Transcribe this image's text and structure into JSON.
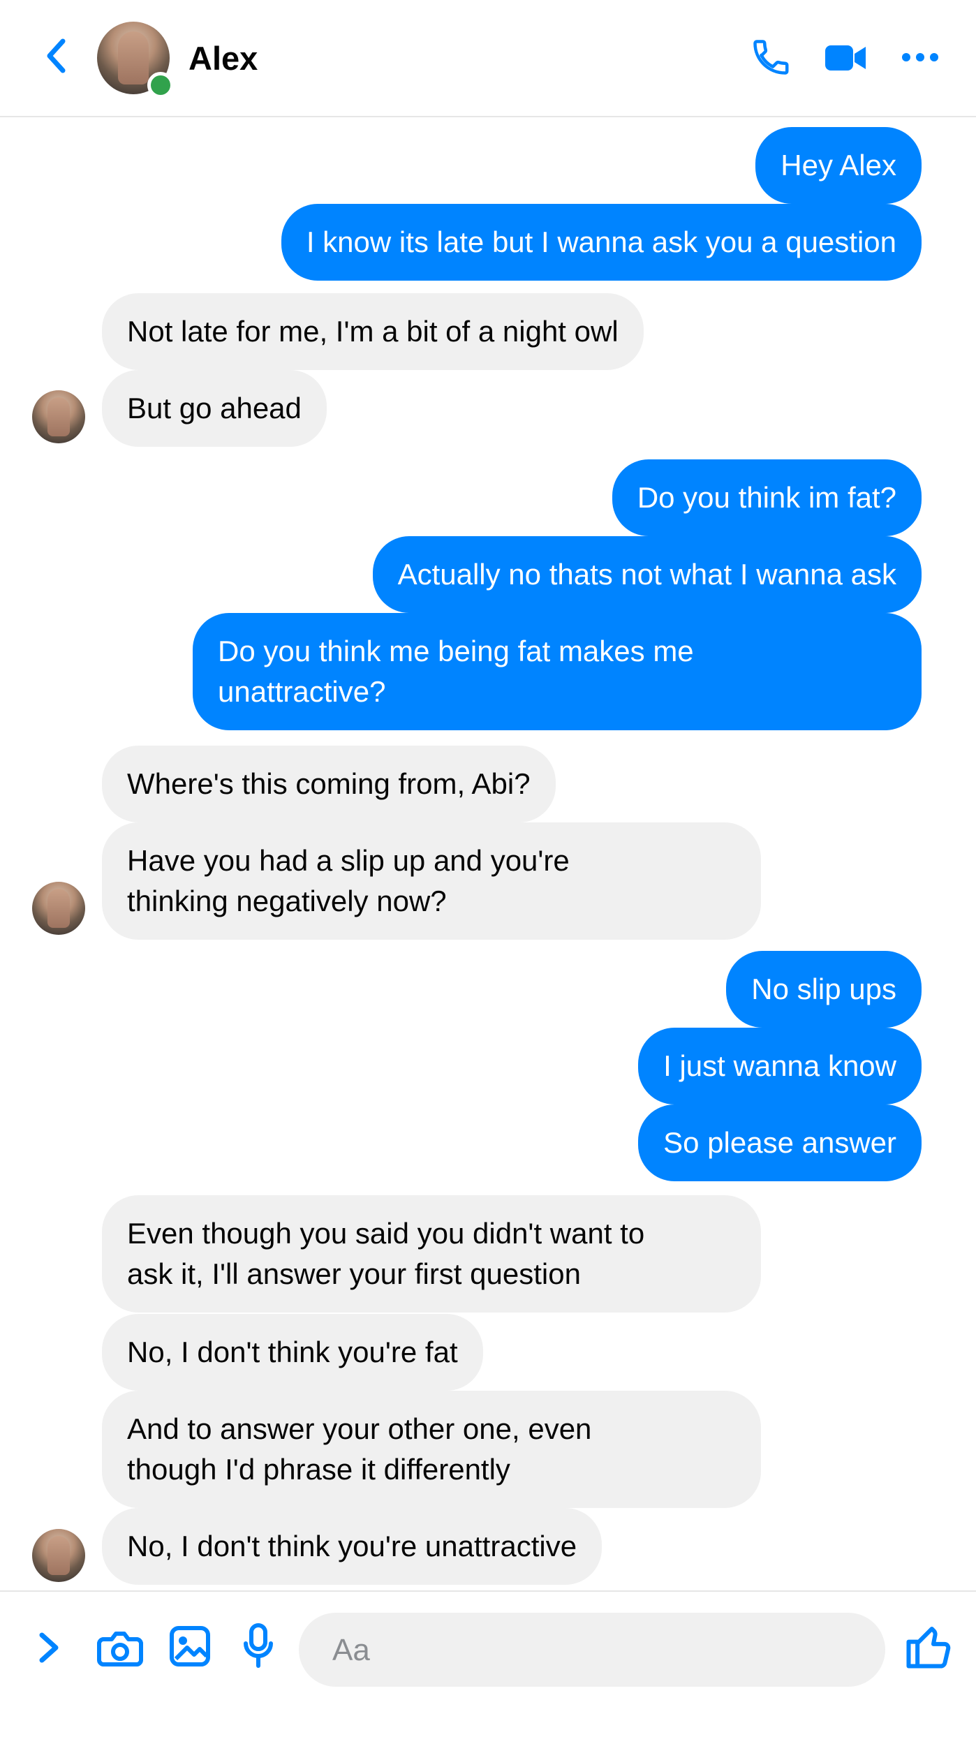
{
  "header": {
    "contact_name": "Alex",
    "online": true,
    "icons": [
      "back-chevron-icon",
      "phone-icon",
      "video-camera-icon",
      "more-icon"
    ]
  },
  "messages": [
    {
      "from": "me",
      "text": "Hey Alex"
    },
    {
      "from": "me",
      "text": "I know its late but I wanna ask you a question"
    },
    {
      "from": "them",
      "text": "Not late for me, I'm a bit of a night owl"
    },
    {
      "from": "them",
      "text": "But go ahead"
    },
    {
      "from": "me",
      "text": "Do you think im fat?"
    },
    {
      "from": "me",
      "text": "Actually no thats not what I wanna ask"
    },
    {
      "from": "me",
      "text": "Do you think me being fat makes me\nunattractive?"
    },
    {
      "from": "them",
      "text": "Where's this coming from, Abi?"
    },
    {
      "from": "them",
      "text": "Have you had a slip up and you're\nthinking negatively now?"
    },
    {
      "from": "me",
      "text": "No slip ups"
    },
    {
      "from": "me",
      "text": "I just wanna know"
    },
    {
      "from": "me",
      "text": "So please answer"
    },
    {
      "from": "them",
      "text": "Even though you said you didn't want to\nask it, I'll answer your first question"
    },
    {
      "from": "them",
      "text": "No, I don't think you're fat"
    },
    {
      "from": "them",
      "text": "And to answer your other one, even\nthough I'd phrase it differently"
    },
    {
      "from": "them",
      "text": "No, I don't think you're unattractive"
    }
  ],
  "composer": {
    "placeholder": "Aa",
    "value": "",
    "icons": [
      "expand-chevron-icon",
      "camera-icon",
      "image-icon",
      "microphone-icon",
      "thumbs-up-icon"
    ]
  },
  "colors": {
    "accent": "#0084FF",
    "incoming_bubble": "#F0F0F0",
    "online_dot": "#31A24C"
  }
}
